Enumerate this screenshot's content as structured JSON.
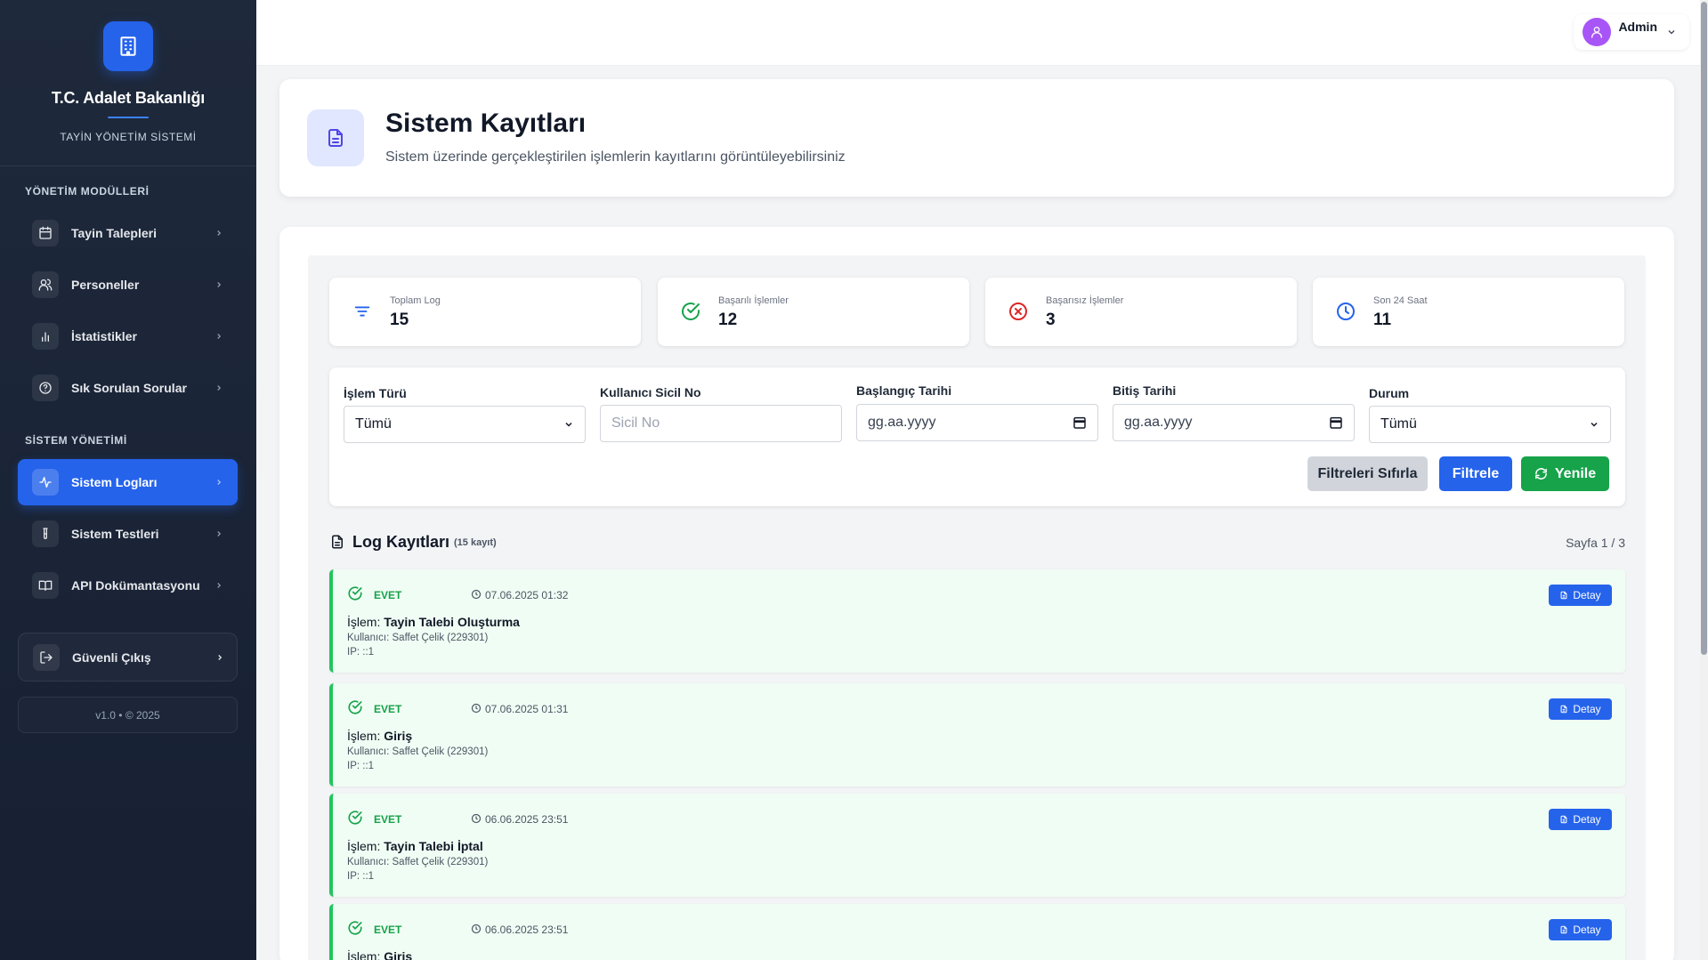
{
  "sidebar": {
    "brand_title": "T.C. Adalet Bakanlığı",
    "brand_subtitle": "TAYİN YÖNETİM SİSTEMİ",
    "section_modules": "YÖNETİM MODÜLLERİ",
    "section_system": "SİSTEM YÖNETİMİ",
    "items": [
      {
        "label": "Tayin Talepleri",
        "icon": "calendar-icon"
      },
      {
        "label": "Personeller",
        "icon": "users-icon"
      },
      {
        "label": "İstatistikler",
        "icon": "bar-chart-icon"
      },
      {
        "label": "Sık Sorulan Sorular",
        "icon": "help-circle-icon"
      },
      {
        "label": "Sistem Logları",
        "icon": "activity-icon",
        "active": true
      },
      {
        "label": "Sistem Testleri",
        "icon": "test-tube-icon"
      },
      {
        "label": "API Dokümantasyonu",
        "icon": "book-icon"
      }
    ],
    "logout_label": "Güvenli Çıkış",
    "version": "v1.0 • © 2025",
    "accent": "#2563eb"
  },
  "topbar": {
    "user_name": "Admin"
  },
  "header": {
    "title": "Sistem Kayıtları",
    "subtitle": "Sistem üzerinde gerçekleştirilen işlemlerin kayıtlarını görüntüleyebilirsiniz"
  },
  "stats": [
    {
      "label": "Toplam Log",
      "value": "15",
      "icon": "filter-icon",
      "color": "#2563eb"
    },
    {
      "label": "Başarılı İşlemler",
      "value": "12",
      "icon": "check-circle-icon",
      "color": "#16a34a"
    },
    {
      "label": "Başarısız İşlemler",
      "value": "3",
      "icon": "x-circle-icon",
      "color": "#dc2626"
    },
    {
      "label": "Son 24 Saat",
      "value": "11",
      "icon": "clock-icon",
      "color": "#2563eb"
    }
  ],
  "filters": {
    "op_type_label": "İşlem Türü",
    "op_type_value": "Tümü",
    "sicil_label": "Kullanıcı Sicil No",
    "sicil_placeholder": "Sicil No",
    "start_label": "Başlangıç Tarihi",
    "start_placeholder": "gg.aa.yyyy",
    "end_label": "Bitiş Tarihi",
    "end_placeholder": "gg.aa.yyyy",
    "status_label": "Durum",
    "status_value": "Tümü",
    "reset_label": "Filtreleri Sıfırla",
    "filter_label": "Filtrele",
    "refresh_label": "Yenile"
  },
  "logs": {
    "title": "Log Kayıtları",
    "count": "(15 kayıt)",
    "page_info": "Sayfa 1 / 3",
    "detail_label": "Detay",
    "op_prefix": "İşlem:",
    "items": [
      {
        "status": "EVET",
        "time": "07.06.2025 01:32",
        "operation": "Tayin Talebi Oluşturma",
        "user": "Kullanıcı: Saffet Çelik (229301)",
        "ip": "IP: ::1"
      },
      {
        "status": "EVET",
        "time": "07.06.2025 01:31",
        "operation": "Giriş",
        "user": "Kullanıcı: Saffet Çelik (229301)",
        "ip": "IP: ::1"
      },
      {
        "status": "EVET",
        "time": "06.06.2025 23:51",
        "operation": "Tayin Talebi İptal",
        "user": "Kullanıcı: Saffet Çelik (229301)",
        "ip": "IP: ::1"
      },
      {
        "status": "EVET",
        "time": "06.06.2025 23:51",
        "operation": "Giriş",
        "user": "",
        "ip": ""
      }
    ]
  }
}
